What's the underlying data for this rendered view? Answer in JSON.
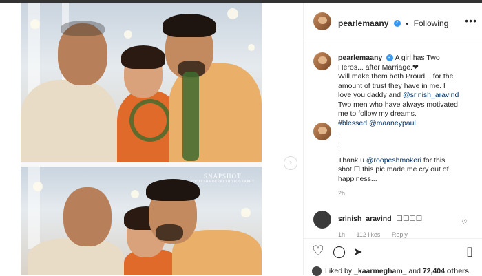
{
  "post": {
    "username": "pearlemaany",
    "follow_status": "Following",
    "more_label": "•••",
    "dot": "•"
  },
  "photo": {
    "watermark_title": "SNAPSHOT",
    "watermark_sub": "ROOPESHMOKERI PHOTOGRAPHY"
  },
  "caption": {
    "username": "pearlemaany",
    "lines": [
      "A girl has Two",
      "Heros... after Marriage.❤",
      "Will make them both Proud... for the",
      "amount of trust they have in me. I",
      "love you daddy and ",
      "Two men who have always motivated",
      "me to follow my dreams.",
      ".",
      ".",
      ".",
      "Thank u ",
      "shot ☐ this pic made me cry out of",
      "happiness..."
    ],
    "mention_srinish": "@srinish_aravind",
    "hashtag_blessed": "#blessed",
    "mention_maaney": "@maaneypaul",
    "mention_roopesh": "@roopeshmokeri",
    "thank_tail": " for this",
    "time": "2h"
  },
  "comment": {
    "username": "srinish_aravind",
    "text": "☐☐☐☐",
    "time": "1h",
    "likes": "112 likes",
    "reply": "Reply"
  },
  "likes": {
    "liked_by_prefix": "Liked by ",
    "liked_by_user": "_kaarmegham_",
    "and_label": " and ",
    "others": "72,404 others"
  },
  "icons": {
    "next": "›",
    "heart": "♡",
    "comment": "◯",
    "share": "➤",
    "bookmark": "▯",
    "small_heart": "♡"
  }
}
